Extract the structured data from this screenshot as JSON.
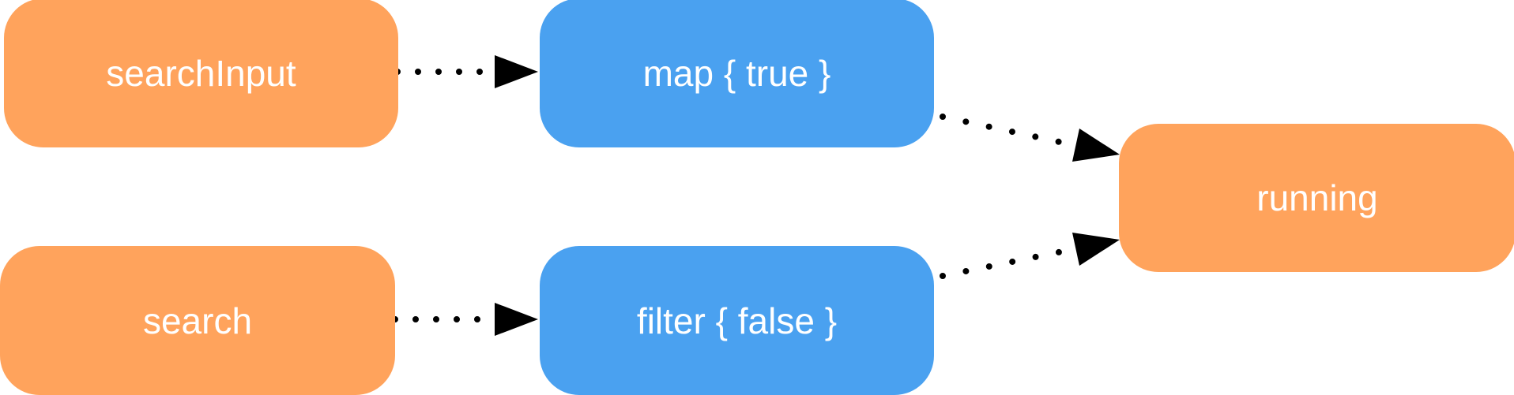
{
  "diagram": {
    "nodes": [
      {
        "id": "searchInput",
        "label": "searchInput",
        "kind": "source"
      },
      {
        "id": "map",
        "label": "map { true }",
        "kind": "operator"
      },
      {
        "id": "running",
        "label": "running",
        "kind": "source"
      },
      {
        "id": "search",
        "label": "search",
        "kind": "source"
      },
      {
        "id": "filter",
        "label": "filter { false }",
        "kind": "operator"
      }
    ],
    "edges": [
      {
        "from": "searchInput",
        "to": "map",
        "style": "dotted"
      },
      {
        "from": "search",
        "to": "filter",
        "style": "dotted"
      },
      {
        "from": "map",
        "to": "running",
        "style": "dotted"
      },
      {
        "from": "filter",
        "to": "running",
        "style": "dotted"
      }
    ]
  },
  "colors": {
    "source_node": "#FFA35C",
    "operator_node": "#4AA1F0",
    "label_text": "#FFFFFF",
    "edge": "#000000"
  }
}
